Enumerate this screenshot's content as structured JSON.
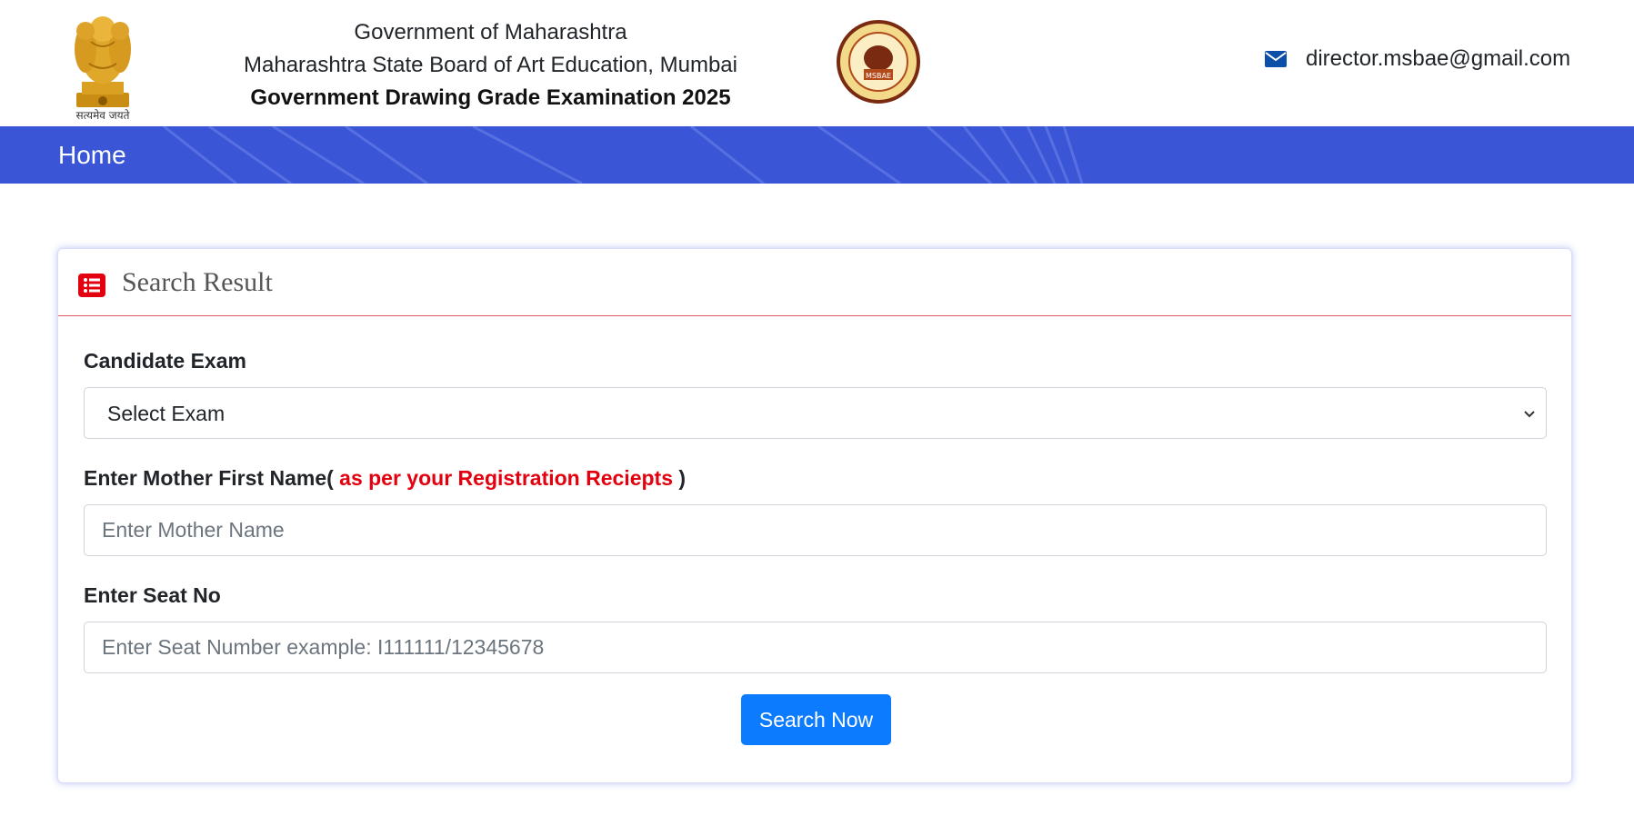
{
  "header": {
    "emblem_caption": "सत्यमेव जयते",
    "line1": "Government of Maharashtra",
    "line2": "Maharashtra State Board of Art Education, Mumbai",
    "line3": "Government Drawing Grade Examination 2025",
    "seal_text": "MSBAE",
    "email": "director.msbae@gmail.com"
  },
  "nav": {
    "home": "Home"
  },
  "card": {
    "title": "Search Result",
    "exam_label": "Candidate Exam",
    "exam_selected": "Select Exam",
    "mother_label": "Enter Mother First Name(",
    "mother_label_note": "as per your Registration Reciepts",
    "mother_label_close": ")",
    "mother_placeholder": "Enter Mother Name",
    "seat_label": "Enter Seat No",
    "seat_placeholder": "Enter Seat Number example: I111111/12345678",
    "button": "Search Now"
  },
  "colors": {
    "nav_bg": "#3a55d6",
    "button_bg": "#0d7bfd",
    "accent_red": "#e3000f",
    "icon_blue": "#0b4fa8"
  },
  "icons": {
    "mail": "envelope-icon",
    "list": "list-icon",
    "select": "chevron-down-icon"
  }
}
